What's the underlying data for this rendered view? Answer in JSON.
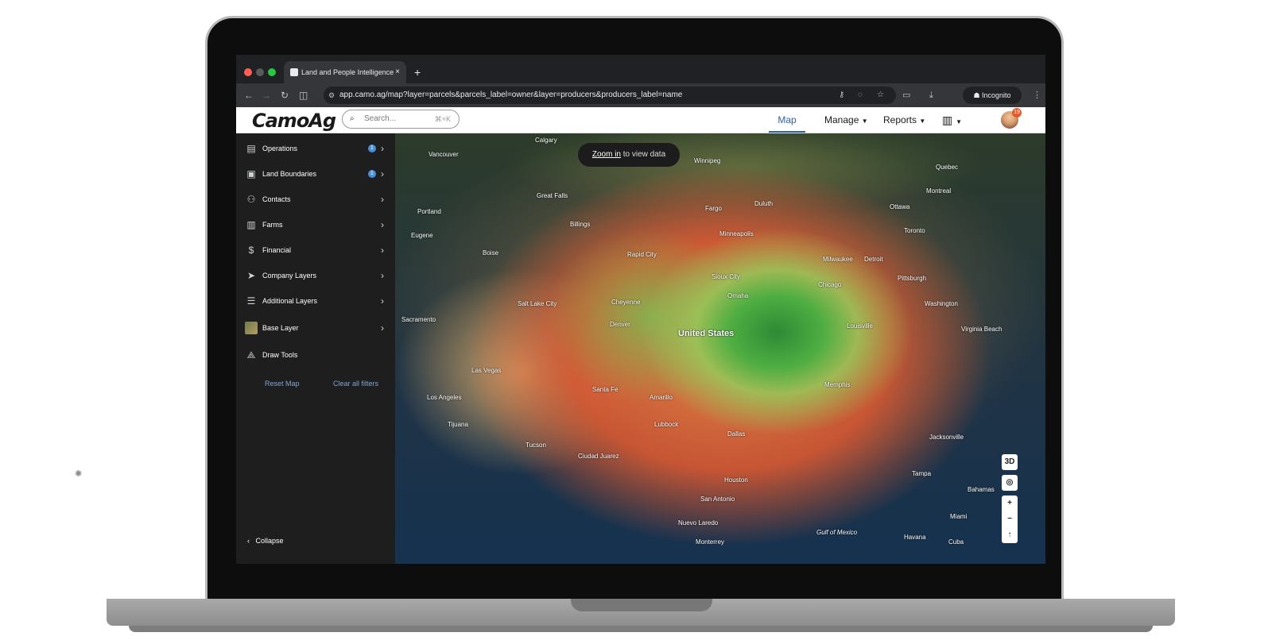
{
  "browser": {
    "tab_title": "Land and People Intelligence",
    "tab_close": "×",
    "new_tab": "+",
    "url": "app.camo.ag/map?layer=parcels&parcels_label=owner&layer=producers&producers_label=name",
    "incognito_label": "Incognito"
  },
  "app": {
    "logo": "CamoAg",
    "search": {
      "placeholder": "Search...",
      "shortcut": "⌘+K"
    },
    "nav": {
      "map": "Map",
      "manage": "Manage",
      "reports": "Reports"
    },
    "notification_count": "19"
  },
  "sidebar": {
    "items": [
      {
        "label": "Operations",
        "icon": "building-icon",
        "count": "1"
      },
      {
        "label": "Land Boundaries",
        "icon": "boundary-icon",
        "count": "1"
      },
      {
        "label": "Contacts",
        "icon": "contacts-icon"
      },
      {
        "label": "Farms",
        "icon": "map-icon"
      },
      {
        "label": "Financial",
        "icon": "document-dollar-icon"
      },
      {
        "label": "Company Layers",
        "icon": "send-icon"
      },
      {
        "label": "Additional Layers",
        "icon": "layers-icon"
      },
      {
        "label": "Base Layer",
        "icon": "base-layer-thumbnail"
      },
      {
        "label": "Draw Tools",
        "icon": "compass-icon"
      }
    ],
    "reset_map": "Reset Map",
    "clear_filters": "Clear all filters",
    "collapse": "Collapse"
  },
  "map": {
    "zoom_hint_link": "Zoom in",
    "zoom_hint_text": "to view data",
    "controls": {
      "three_d": "3D",
      "zoom_in": "+",
      "zoom_out": "−"
    },
    "labels": {
      "country": "United States",
      "cities": [
        "Vancouver",
        "Calgary",
        "Winnipeg",
        "Quebec",
        "Montreal",
        "Ottawa",
        "Toronto",
        "Portland",
        "Eugene",
        "Boise",
        "Great Falls",
        "Billings",
        "Rapid City",
        "Fargo",
        "Duluth",
        "Minneapolis",
        "Milwaukee",
        "Detroit",
        "Chicago",
        "Sioux City",
        "Omaha",
        "Salt Lake City",
        "Cheyenne",
        "Denver",
        "Sacramento",
        "Las Vegas",
        "Los Angeles",
        "Tijuana",
        "Santa Fe",
        "Amarillo",
        "Lubbock",
        "Dallas",
        "Houston",
        "San Antonio",
        "Memphis",
        "Louisville",
        "Pittsburgh",
        "Washington",
        "Virginia Beach",
        "Jacksonville",
        "Tampa",
        "Miami",
        "Havana",
        "Cuba",
        "Bahamas",
        "Ciudad Juarez",
        "Tucson",
        "Monterrey",
        "Nuevo Laredo",
        "Gulf of Mexico"
      ]
    }
  },
  "colors": {
    "heat_low": "#2f8a35",
    "heat_mid": "#e9a25c",
    "heat_high": "#d9482f",
    "sidebar_bg": "#1e1e1e",
    "active_nav": "#2f5eae",
    "count_badge": "#4a90d9"
  }
}
